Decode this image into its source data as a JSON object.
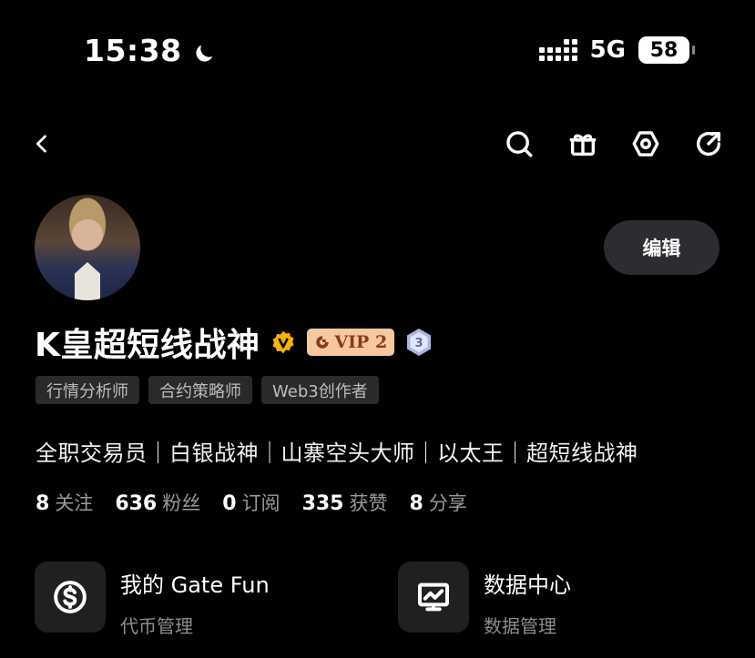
{
  "status_bar": {
    "time": "15:38",
    "network": "5G",
    "battery": "58"
  },
  "nav": {
    "icons": [
      "back-icon",
      "search-icon",
      "gift-icon",
      "settings-icon",
      "share-icon"
    ]
  },
  "profile": {
    "edit_label": "编辑",
    "username": "K皇超短线战神",
    "vip_label": "VIP 2",
    "level": "3",
    "tags": [
      "行情分析师",
      "合约策略师",
      "Web3创作者"
    ],
    "bio": "全职交易员｜白银战神｜山寨空头大师｜以太王｜超短线战神",
    "stats": [
      {
        "value": "8",
        "label": "关注"
      },
      {
        "value": "636",
        "label": "粉丝"
      },
      {
        "value": "0",
        "label": "订阅"
      },
      {
        "value": "335",
        "label": "获赞"
      },
      {
        "value": "8",
        "label": "分享"
      }
    ]
  },
  "cards": [
    {
      "title": "我的 Gate Fun",
      "subtitle": "代币管理",
      "icon": "dollar-icon"
    },
    {
      "title": "数据中心",
      "subtitle": "数据管理",
      "icon": "chart-monitor-icon"
    }
  ],
  "colors": {
    "background": "#000000",
    "vip_bg": "#f6c89f",
    "verified": "#f5b400",
    "level_badge": "#a9b6e0"
  }
}
